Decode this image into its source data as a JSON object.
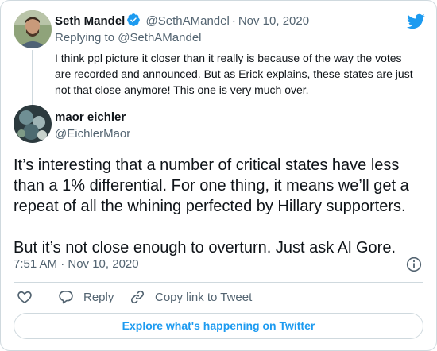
{
  "parent_tweet": {
    "display_name": "Seth Mandel",
    "handle": "@SethAMandel",
    "separator": "·",
    "date": "Nov 10, 2020",
    "replying_to": "Replying to @SethAMandel",
    "text": "I think ppl picture it closer than it really is because of the way the votes are recorded and announced. But as Erick explains, these states are just not that close anymore! This one is very much over."
  },
  "main_tweet": {
    "display_name": "maor eichler",
    "handle": "@EichlerMaor",
    "paragraphs": [
      "It’s interesting that a number of critical states have less than a 1% differential. For one thing, it means we’ll get a repeat of all the whining perfected by Hillary supporters.",
      "But it’s not close enough to overturn. Just ask Al Gore."
    ],
    "timestamp": "7:51 AM · Nov 10, 2020"
  },
  "actions": {
    "reply_label": "Reply",
    "copy_link_label": "Copy link to Tweet"
  },
  "footer": {
    "explore_label": "Explore what's happening on Twitter"
  },
  "icons": {
    "brand": "twitter-bird-icon",
    "verified": "verified-badge-icon",
    "info": "info-icon",
    "like": "heart-icon",
    "reply": "reply-bubble-icon",
    "link": "link-icon"
  },
  "colors": {
    "brand_blue": "#1d9bf0",
    "text": "#0f1419",
    "muted": "#536471",
    "border": "#cfd9de"
  }
}
